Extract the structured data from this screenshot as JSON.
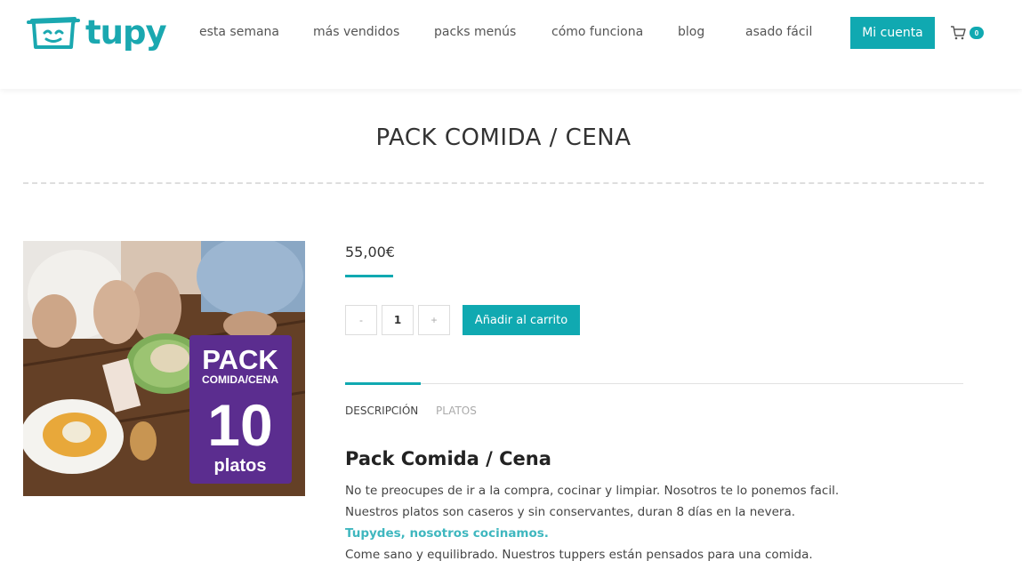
{
  "brand": {
    "name": "tupy",
    "color": "#10a9b1"
  },
  "nav": {
    "items": [
      {
        "label": "esta semana"
      },
      {
        "label": "más vendidos"
      },
      {
        "label": "packs menús"
      },
      {
        "label": "cómo funciona"
      },
      {
        "label": "blog"
      },
      {
        "label": "asado fácil"
      }
    ],
    "account_label": "Mi cuenta",
    "cart_count": "0"
  },
  "page": {
    "title": "PACK COMIDA / CENA"
  },
  "product": {
    "price": "55,00€",
    "quantity": "1",
    "minus_label": "-",
    "plus_label": "+",
    "add_to_cart_label": "Añadir al carrito",
    "image_badge": {
      "line1": "PACK",
      "line2": "COMIDA/CENA",
      "line3": "10",
      "line4": "platos"
    }
  },
  "tabs": [
    {
      "label": "DESCRIPCIÓN",
      "active": true
    },
    {
      "label": "PLATOS",
      "active": false
    }
  ],
  "description": {
    "heading": "Pack Comida / Cena",
    "lines": [
      "No te preocupes de ir a la compra, cocinar y limpiar. Nosotros te lo ponemos facil.",
      "Nuestros platos son caseros y sin conservantes, duran 8 días en la nevera.",
      "Tupydes, nosotros cocinamos.",
      "Come sano y equilibrado. Nuestros tuppers están pensados para una comida."
    ]
  }
}
